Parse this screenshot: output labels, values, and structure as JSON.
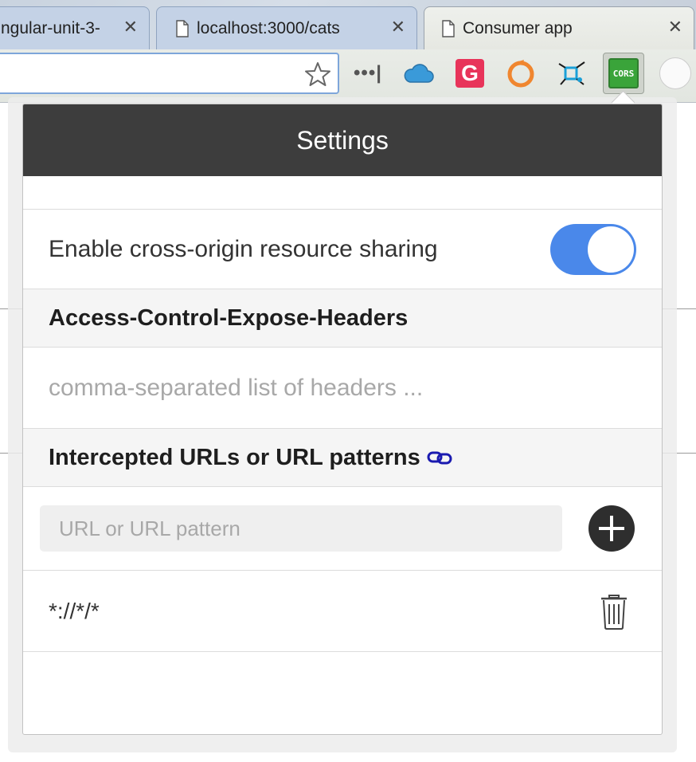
{
  "browser": {
    "tabs": [
      {
        "title": "ngular-unit-3-",
        "close": "✕"
      },
      {
        "title": "localhost:3000/cats",
        "close": "✕"
      },
      {
        "title": "Consumer app",
        "close": "✕"
      }
    ],
    "toolbar": {
      "overflow_label": "•••|",
      "extensions": [
        {
          "icon": "cloud-icon"
        },
        {
          "label": "G",
          "icon": "grammarly-icon",
          "color": "#e8345a"
        },
        {
          "icon": "orange-ring-icon",
          "color": "#f0862f"
        },
        {
          "icon": "network-icon",
          "color": "#1aa0d8"
        },
        {
          "label": "CORS",
          "icon": "cors-icon",
          "color": "#3aa43a"
        },
        {
          "icon": "page-icon"
        }
      ]
    }
  },
  "popup": {
    "title": "Settings",
    "toggle": {
      "label": "Enable cross-origin resource sharing",
      "enabled": true,
      "color": "#4a88ea"
    },
    "expose_headers": {
      "heading": "Access-Control-Expose-Headers",
      "placeholder": "comma-separated list of headers ...",
      "value": ""
    },
    "intercept": {
      "heading": "Intercepted URLs or URL patterns",
      "input_placeholder": "URL or URL pattern",
      "patterns": [
        "*://*/*"
      ]
    }
  }
}
